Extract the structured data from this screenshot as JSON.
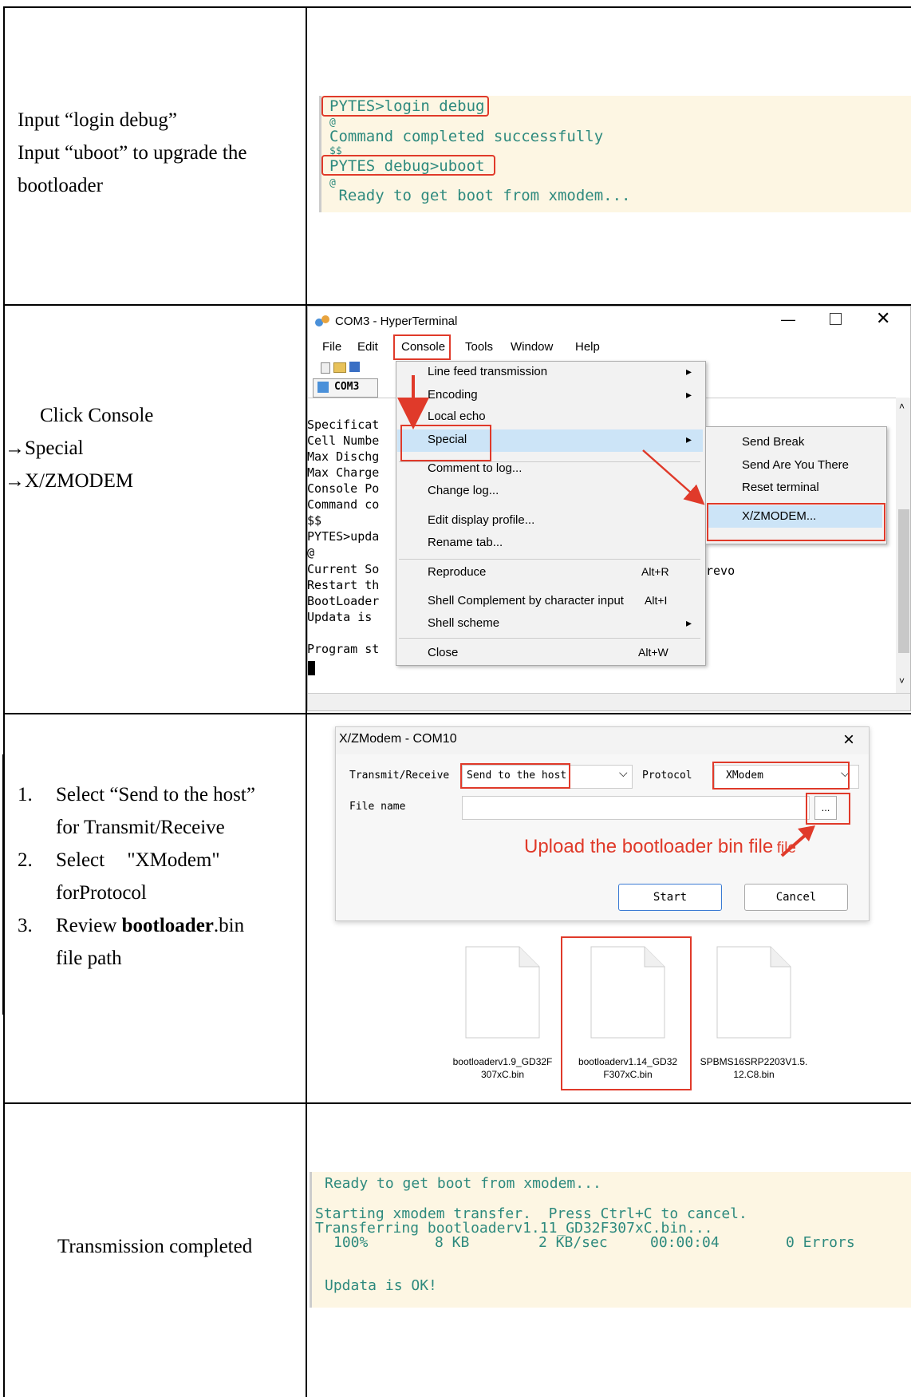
{
  "row1": {
    "instr_line1": "Input “login debug”",
    "instr_line2": "Input “uboot” to upgrade the",
    "instr_line3": "bootloader",
    "terminal": {
      "l1": "PYTES>login debug",
      "l2": "@",
      "l3": "Command completed successfully",
      "l4": "$$",
      "l5": "PYTES_debug>uboot",
      "l6": "@",
      "l7": " Ready to get boot from xmodem..."
    }
  },
  "row2": {
    "instr_line1": "Click Console",
    "instr_line2": "→Special",
    "instr_line3": "→X/ZMODEM",
    "window": {
      "title": "COM3 - HyperTerminal",
      "menu": [
        "File",
        "Edit",
        "Console",
        "Tools",
        "Window",
        "Help"
      ],
      "tab_label": "COM3",
      "console_lines": [
        "Specificat",
        "Cell Numbe",
        "Max Dischg",
        "Max Charge",
        "Console Po",
        "Command co",
        "$$",
        "PYTES>upda",
        "@",
        "Current So",
        "Restart th",
        "BootLoader",
        "Updata is",
        "",
        "Program st"
      ],
      "console_tail": "revo",
      "dropdown": [
        {
          "label": "Line feed transmission",
          "shortcut": "▸"
        },
        {
          "label": "Encoding",
          "shortcut": "▸"
        },
        {
          "label": "Local echo",
          "shortcut": ""
        },
        {
          "label": "Special",
          "shortcut": "▸"
        },
        {
          "label": "Comment to log...",
          "shortcut": ""
        },
        {
          "label": "Change log...",
          "shortcut": ""
        },
        {
          "label": "Edit display profile...",
          "shortcut": ""
        },
        {
          "label": "Rename tab...",
          "shortcut": ""
        },
        {
          "label": "Reproduce",
          "shortcut": "Alt+R"
        },
        {
          "label": "Shell Complement by character input",
          "shortcut": "Alt+I"
        },
        {
          "label": "Shell scheme",
          "shortcut": "▸"
        },
        {
          "label": "Close",
          "shortcut": "Alt+W"
        }
      ],
      "submenu": [
        "Send Break",
        "Send Are You There",
        "Reset terminal",
        "X/ZMODEM..."
      ]
    }
  },
  "row3": {
    "steps": [
      {
        "num": "1.",
        "line1": "Select “Send to the host”",
        "line2": "for Transmit/Receive"
      },
      {
        "num": "2.",
        "line1": "Select \"XModem\"",
        "line2": "forProtocol"
      },
      {
        "num": "3.",
        "line1_pre": "Review ",
        "line1_bold": "bootloader",
        "line1_post": ".bin",
        "line2": "file path"
      }
    ],
    "dialog": {
      "title": "X/ZModem - COM10",
      "close": "×",
      "tr_label": "Transmit/Receive",
      "tr_value": "Send to the host",
      "protocol_label": "Protocol",
      "protocol_value": "XModem",
      "file_label": "File name",
      "file_value": "",
      "browse": "...",
      "annotation": "Upload the bootloader bin file",
      "annotation_suffix": "file",
      "start": "Start",
      "cancel": "Cancel"
    },
    "files": [
      {
        "l1": "bootloaderv1.9_GD32F",
        "l2": "307xC.bin"
      },
      {
        "l1": "bootloaderv1.14_GD32",
        "l2": "F307xC.bin"
      },
      {
        "l1": "SPBMS16SRP2203V1.5.",
        "l2": "12.C8.bin"
      }
    ]
  },
  "row4": {
    "instr": "Transmission completed",
    "terminal": {
      "l1": "Ready to get boot from xmodem...",
      "l2": "Starting xmodem transfer.  Press Ctrl+C to cancel.",
      "l3": "Transferring bootloaderv1.11_GD32F307xC.bin...",
      "l4_pct": "100%",
      "l4_size": "8 KB",
      "l4_rate": "2 KB/sec",
      "l4_time": "00:00:04",
      "l4_err": "0 Errors",
      "l5": "Updata is OK!"
    }
  },
  "colors": {
    "accent_red": "#e03a2a",
    "terminal_bg": "#fdf6e3",
    "terminal_text": "#2e8a7e",
    "menu_highlight": "#cce4f7"
  }
}
